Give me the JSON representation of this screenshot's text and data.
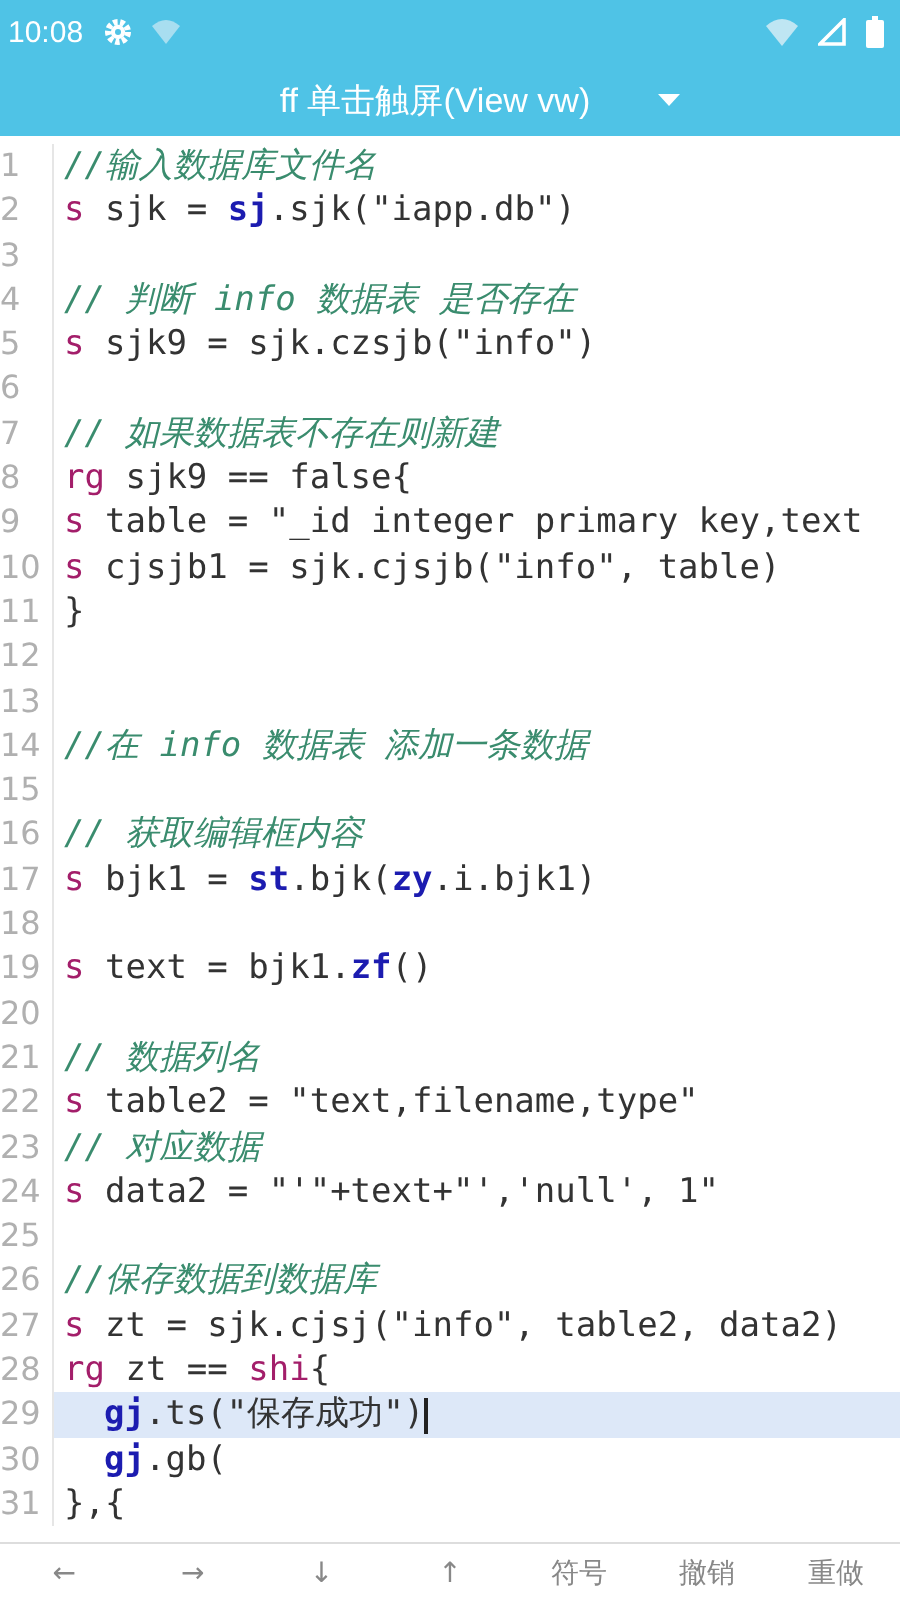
{
  "status_bar": {
    "time": "10:08"
  },
  "title_bar": {
    "title": "ff 单击触屏(View vw)"
  },
  "editor": {
    "lines": [
      {
        "number": "1",
        "current": false,
        "tokens": [
          {
            "kind": "comment",
            "text": "//输入数据库文件名"
          }
        ]
      },
      {
        "number": "2",
        "current": false,
        "tokens": [
          {
            "kind": "keyword",
            "text": "s"
          },
          {
            "kind": "plain",
            "text": " sjk = "
          },
          {
            "kind": "builtin",
            "text": "sj"
          },
          {
            "kind": "plain",
            "text": ".sjk(\"iapp.db\")"
          }
        ]
      },
      {
        "number": "3",
        "current": false
      },
      {
        "number": "4",
        "current": false,
        "tokens": [
          {
            "kind": "comment",
            "text": "// 判断 info 数据表 是否存在"
          }
        ]
      },
      {
        "number": "5",
        "current": false,
        "tokens": [
          {
            "kind": "keyword",
            "text": "s"
          },
          {
            "kind": "plain",
            "text": " sjk9 = sjk.czsjb(\"info\")"
          }
        ]
      },
      {
        "number": "6",
        "current": false
      },
      {
        "number": "7",
        "current": false,
        "tokens": [
          {
            "kind": "comment",
            "text": "// 如果数据表不存在则新建"
          }
        ]
      },
      {
        "number": "8",
        "current": false,
        "tokens": [
          {
            "kind": "keyword",
            "text": "rg"
          },
          {
            "kind": "plain",
            "text": " sjk9 == false{"
          }
        ]
      },
      {
        "number": "9",
        "current": false,
        "tokens": [
          {
            "kind": "keyword",
            "text": "s"
          },
          {
            "kind": "plain",
            "text": " table = \"_id integer primary key,text"
          }
        ]
      },
      {
        "number": "10",
        "current": false,
        "tokens": [
          {
            "kind": "keyword",
            "text": "s"
          },
          {
            "kind": "plain",
            "text": " cjsjb1 = sjk.cjsjb(\"info\", table)"
          }
        ]
      },
      {
        "number": "11",
        "current": false,
        "tokens": [
          {
            "kind": "plain",
            "text": "}"
          }
        ]
      },
      {
        "number": "12",
        "current": false
      },
      {
        "number": "13",
        "current": false
      },
      {
        "number": "14",
        "current": false,
        "tokens": [
          {
            "kind": "comment",
            "text": "//在 info 数据表 添加一条数据"
          }
        ]
      },
      {
        "number": "15",
        "current": false
      },
      {
        "number": "16",
        "current": false,
        "tokens": [
          {
            "kind": "comment",
            "text": "// 获取编辑框内容"
          }
        ]
      },
      {
        "number": "17",
        "current": false,
        "tokens": [
          {
            "kind": "keyword",
            "text": "s"
          },
          {
            "kind": "plain",
            "text": " bjk1 = "
          },
          {
            "kind": "builtin",
            "text": "st"
          },
          {
            "kind": "plain",
            "text": ".bjk("
          },
          {
            "kind": "builtin",
            "text": "zy"
          },
          {
            "kind": "plain",
            "text": ".i.bjk1)"
          }
        ]
      },
      {
        "number": "18",
        "current": false
      },
      {
        "number": "19",
        "current": false,
        "tokens": [
          {
            "kind": "keyword",
            "text": "s"
          },
          {
            "kind": "plain",
            "text": " text = bjk1."
          },
          {
            "kind": "builtin",
            "text": "zf"
          },
          {
            "kind": "plain",
            "text": "()"
          }
        ]
      },
      {
        "number": "20",
        "current": false
      },
      {
        "number": "21",
        "current": false,
        "tokens": [
          {
            "kind": "comment",
            "text": "// 数据列名"
          }
        ]
      },
      {
        "number": "22",
        "current": false,
        "tokens": [
          {
            "kind": "keyword",
            "text": "s"
          },
          {
            "kind": "plain",
            "text": " table2 = \"text,filename,type\""
          }
        ]
      },
      {
        "number": "23",
        "current": false,
        "tokens": [
          {
            "kind": "comment",
            "text": "// 对应数据"
          }
        ]
      },
      {
        "number": "24",
        "current": false,
        "tokens": [
          {
            "kind": "keyword",
            "text": "s"
          },
          {
            "kind": "plain",
            "text": " data2 = \"'\"+text+\"','null', 1\""
          }
        ]
      },
      {
        "number": "25",
        "current": false
      },
      {
        "number": "26",
        "current": false,
        "tokens": [
          {
            "kind": "comment",
            "text": "//保存数据到数据库"
          }
        ]
      },
      {
        "number": "27",
        "current": false,
        "tokens": [
          {
            "kind": "keyword",
            "text": "s"
          },
          {
            "kind": "plain",
            "text": " zt = sjk.cjsj(\"info\", table2, data2)"
          }
        ]
      },
      {
        "number": "28",
        "current": false,
        "tokens": [
          {
            "kind": "keyword",
            "text": "rg"
          },
          {
            "kind": "plain",
            "text": " zt == "
          },
          {
            "kind": "keyword",
            "text": "shi"
          },
          {
            "kind": "plain",
            "text": "{"
          }
        ]
      },
      {
        "number": "29",
        "current": true,
        "indented": true,
        "tokens": [
          {
            "kind": "builtin",
            "text": "gj"
          },
          {
            "kind": "plain",
            "text": ".ts(\"保存成功\")"
          }
        ]
      },
      {
        "number": "30",
        "current": false,
        "indented": true,
        "tokens": [
          {
            "kind": "builtin",
            "text": "gj"
          },
          {
            "kind": "plain",
            "text": ".gb("
          }
        ]
      },
      {
        "number": "31",
        "current": false,
        "tokens": [
          {
            "kind": "plain",
            "text": "},{"
          }
        ]
      }
    ]
  },
  "toolbar": {
    "keys": [
      "←",
      "→",
      "↓",
      "↑",
      "符号",
      "撤销",
      "重做"
    ]
  }
}
